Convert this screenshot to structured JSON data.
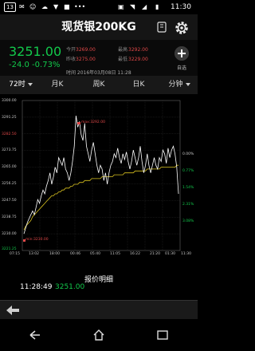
{
  "status": {
    "badge1": "13",
    "time": "11:30"
  },
  "header": {
    "title": "现货银200KG"
  },
  "quote": {
    "price": "3251.00",
    "change": "-24.0  -0.73%",
    "open_label": "今开",
    "open_value": "3269.00",
    "high_label": "最高",
    "high_value": "3292.00",
    "prev_label": "昨收",
    "prev_value": "3275.00",
    "low_label": "最低",
    "low_value": "3229.00",
    "date_line": "时间  2016年03月08日 11:28",
    "add_label": "自选"
  },
  "tabs": [
    {
      "label": "72时"
    },
    {
      "label": "月K"
    },
    {
      "label": "周K"
    },
    {
      "label": "日K"
    },
    {
      "label": "分钟"
    }
  ],
  "chart_data": {
    "type": "line",
    "y_left_ticks": [
      "3300.00",
      "3291.25",
      "3282.50",
      "3273.75",
      "3265.00",
      "3256.25",
      "3247.50",
      "3238.75",
      "3230.00",
      "3221.25"
    ],
    "y_right_ticks": [
      "0.00%",
      "0.77%",
      "1.54%",
      "2.31%",
      "3.08%"
    ],
    "x_ticks": [
      "07:15",
      "13:02",
      "18:00",
      "00:46",
      "05:40",
      "11:05",
      "16:22",
      "21:20",
      "01:30",
      "11:30"
    ],
    "high_marker": "max:3292.00",
    "low_marker": "min:3230.00",
    "series": [
      {
        "values": [
          3230,
          3233,
          3236,
          3238,
          3240,
          3242,
          3240,
          3244,
          3248,
          3246,
          3250,
          3253,
          3251,
          3255,
          3258,
          3262,
          3256,
          3260,
          3265,
          3262,
          3270,
          3268,
          3266,
          3270,
          3264,
          3262,
          3258,
          3262,
          3268,
          3276,
          3292,
          3286,
          3289,
          3282,
          3279,
          3288,
          3276,
          3272,
          3268,
          3274,
          3278,
          3272,
          3266,
          3262,
          3266,
          3264,
          3258,
          3262,
          3256,
          3262,
          3266,
          3268,
          3272,
          3270,
          3275,
          3270,
          3267,
          3272,
          3269,
          3273,
          3268,
          3264,
          3268,
          3274,
          3270,
          3266,
          3270,
          3276,
          3268,
          3262,
          3266,
          3272,
          3266,
          3262,
          3266,
          3270,
          3266,
          3264,
          3270,
          3268,
          3274,
          3272,
          3267,
          3275,
          3270,
          3274,
          3276,
          3272,
          3265,
          3251
        ]
      },
      {
        "values": [
          3232,
          3234,
          3235,
          3236,
          3237,
          3239,
          3240,
          3241,
          3242,
          3243,
          3244,
          3245,
          3246,
          3247,
          3248,
          3249,
          3250,
          3250,
          3251,
          3251,
          3252,
          3252,
          3253,
          3253,
          3254,
          3254,
          3254,
          3255,
          3255,
          3256,
          3256,
          3256,
          3257,
          3257,
          3257,
          3258,
          3258,
          3258,
          3258,
          3259,
          3259,
          3259,
          3259,
          3259,
          3259,
          3260,
          3260,
          3260,
          3260,
          3260,
          3260,
          3260,
          3261,
          3261,
          3261,
          3261,
          3261,
          3261,
          3262,
          3262,
          3262,
          3262,
          3262,
          3262,
          3263,
          3263,
          3263,
          3263,
          3263,
          3263,
          3263,
          3264,
          3264,
          3264,
          3264,
          3264,
          3264,
          3264,
          3264,
          3265,
          3265,
          3265,
          3265,
          3265,
          3265,
          3265,
          3265,
          3265,
          3266,
          3266
        ]
      }
    ],
    "ylim": [
      3221.25,
      3300.0
    ],
    "colors": {
      "price": "#ffffff",
      "average": "#d9c21f"
    }
  },
  "detail": {
    "header": "报价明细",
    "time": "11:28:49",
    "price": "3251.00"
  },
  "icons": {
    "back": "back-arrow-icon",
    "settings": "gear-icon",
    "add": "add-icon",
    "rotate": "rotate-screen-icon"
  }
}
